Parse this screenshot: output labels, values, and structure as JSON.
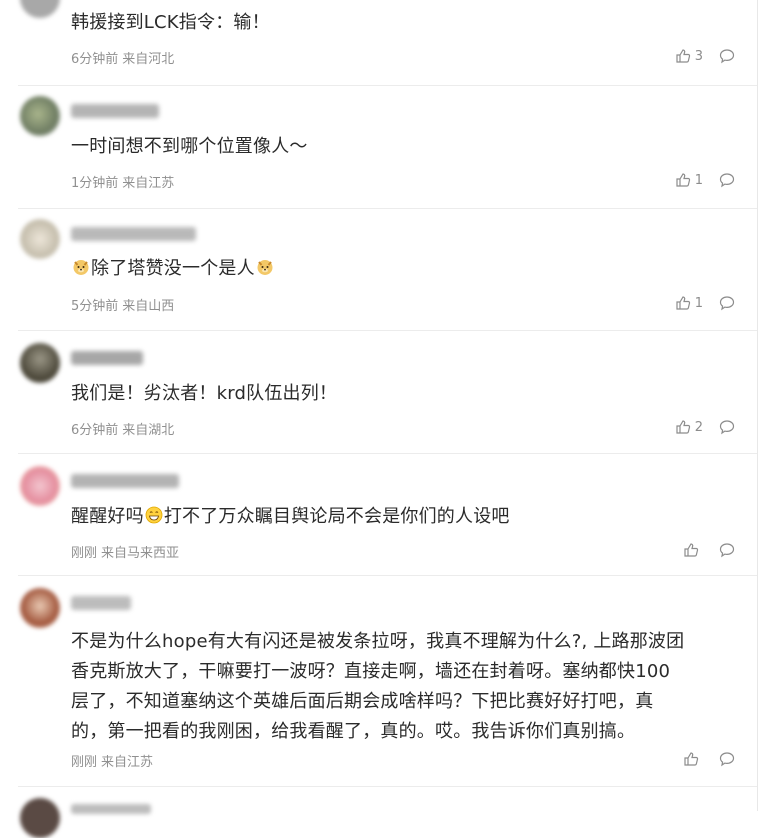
{
  "comments": [
    {
      "text": "韩援接到LCK指令：输！",
      "time": "6分钟前",
      "location": "来自河北",
      "likes": "3"
    },
    {
      "text": "一时间想不到哪个位置像人～",
      "time": "1分钟前",
      "location": "来自江苏",
      "likes": "1"
    },
    {
      "text_before": "",
      "text_mid": "除了塔赞没一个是人",
      "time": "5分钟前",
      "location": "来自山西",
      "likes": "1",
      "emoji_a": "doge-emoji",
      "emoji_b": "doge-emoji"
    },
    {
      "text": "我们是！劣汰者！krd队伍出列！",
      "time": "6分钟前",
      "location": "来自湖北",
      "likes": "2"
    },
    {
      "text_before": "醒醒好吗",
      "text_after": "打不了万众瞩目舆论局不会是你们的人设吧",
      "time": "刚刚",
      "location": "来自马来西亚",
      "likes": "",
      "emoji": "grin-emoji"
    },
    {
      "lines": [
        "不是为什么hope有大有闪还是被发条拉呀，我真不理解为什么?, 上路那波团",
        "香克斯放大了，干嘛要打一波呀？直接走啊，墙还在封着呀。塞纳都快100",
        "层了，不知道塞纳这个英雄后面后期会成啥样吗？下把比赛好好打吧，真",
        "的，第一把看的我刚困，给我看醒了，真的。哎。我告诉你们真别搞。"
      ],
      "time": "刚刚",
      "location": "来自江苏",
      "likes": ""
    }
  ],
  "colors": {
    "text": "#2b2b2b",
    "meta": "#909090",
    "icon": "#8c8c8c",
    "separator": "#ececec"
  },
  "icons": {
    "like": "thumbs-up-icon",
    "reply": "comment-bubble-icon"
  }
}
